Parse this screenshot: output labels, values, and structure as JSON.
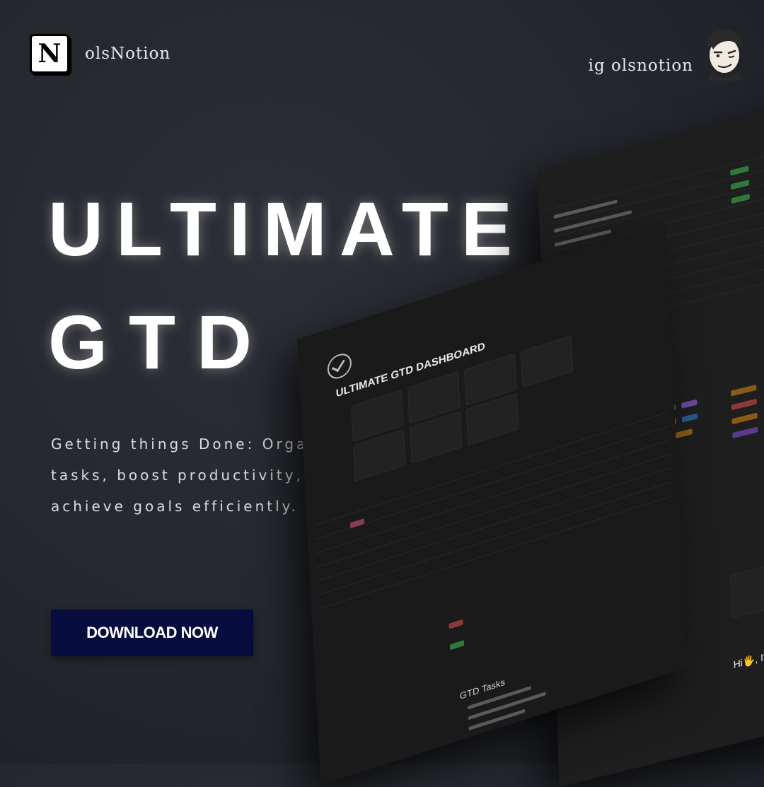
{
  "brand": {
    "logo_letter": "N",
    "name": "olsNotion"
  },
  "social": {
    "handle": "ig olsnotion"
  },
  "headline": {
    "line1": "ULTIMATE",
    "line2": "GTD"
  },
  "description": "Getting things Done: Organize tasks, boost productivity, achieve goals efficiently.",
  "cta": {
    "label": "DOWNLOAD NOW"
  },
  "mockup": {
    "dashboard_title": "ULTIMATE GTD DASHBOARD",
    "gtd_tasks_title": "GTD Tasks",
    "greeting": "Hi🖐, I'm Osama"
  },
  "colors": {
    "background": "#24272d",
    "cta_background": "#070d3f",
    "text": "#ffffff"
  }
}
